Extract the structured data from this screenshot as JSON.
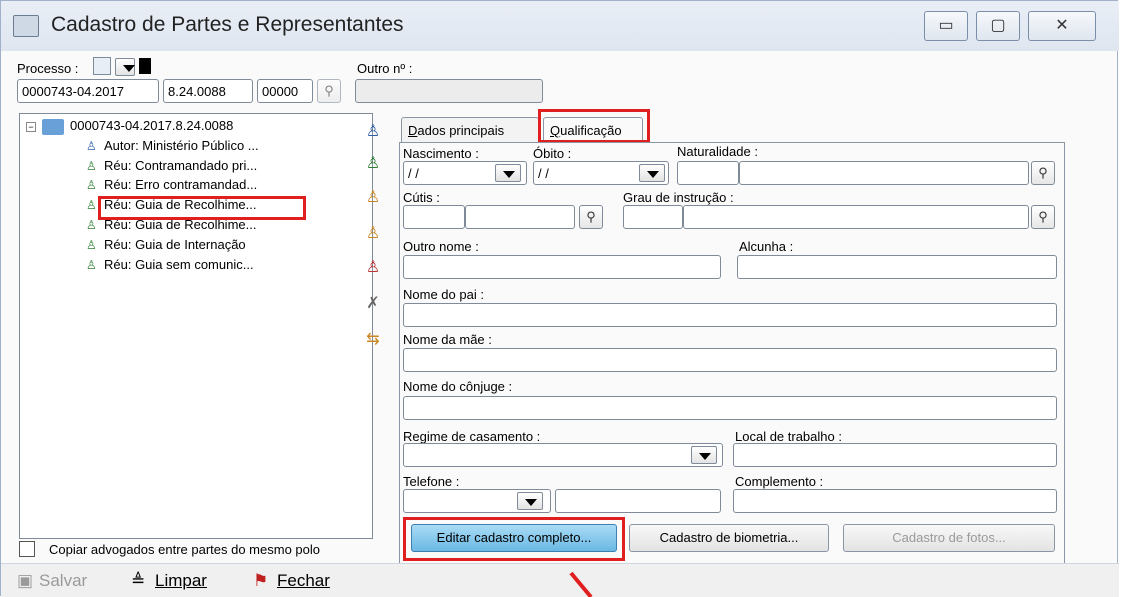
{
  "window": {
    "title": "Cadastro de Partes e Representantes",
    "min_glyph": "▭",
    "max_glyph": "▢",
    "close_glyph": "✕"
  },
  "process": {
    "label": "Processo :",
    "other_label": "Outro nº :",
    "field1": "0000743-04.2017",
    "field2": "8.24.0088",
    "field3": "00000",
    "other_value": ""
  },
  "tree": {
    "root": "0000743-04.2017.8.24.0088",
    "items": [
      "Autor: Ministério Público ...",
      "Réu: Contramandado pri...",
      "Réu: Erro contramandad...",
      "Réu: Guia de Recolhime...",
      "Réu: Guia de Recolhime...",
      "Réu: Guia de Internação",
      "Réu: Guia sem comunic..."
    ],
    "copy_checkbox_label": "Copiar advogados entre partes do mesmo polo"
  },
  "tabs": {
    "main": "Dados principais",
    "main_underline": "D",
    "main_rest": "ados principais",
    "qual_underline": "Q",
    "qual_rest": "ualificação"
  },
  "form": {
    "nascimento_label": "Nascimento :",
    "nascimento_value": "/ /",
    "obito_label": "Óbito :",
    "obito_value": "/ /",
    "naturalidade_label": "Naturalidade :",
    "cutis_label": "Cútis :",
    "grau_label": "Grau de instrução :",
    "outro_nome_label": "Outro nome :",
    "alcunha_label": "Alcunha :",
    "pai_label": "Nome do pai :",
    "mae_label": "Nome da mãe :",
    "conjuge_label": "Nome do cônjuge :",
    "regime_label": "Regime de casamento :",
    "local_trabalho_label": "Local de trabalho :",
    "telefone_label": "Telefone :",
    "complemento_label": "Complemento :"
  },
  "buttons": {
    "editar": "Editar cadastro completo...",
    "biometria": "Cadastro de biometria...",
    "fotos": "Cadastro de fotos..."
  },
  "bottom": {
    "salvar": "Salvar",
    "limpar": "Limpar",
    "fechar": "Fechar"
  },
  "colors": {
    "highlight": "#e02020",
    "editar_button": "#7fc6ea"
  }
}
